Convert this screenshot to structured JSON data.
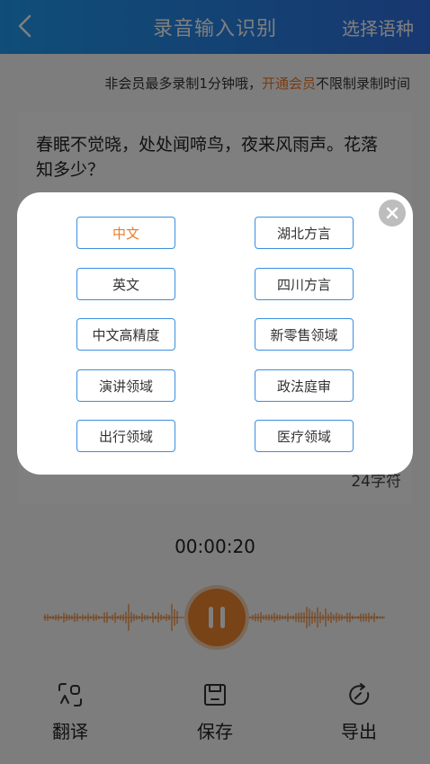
{
  "header": {
    "title": "录音输入识别",
    "lang_button": "选择语种"
  },
  "notice": {
    "prefix": "非会员最多录制1分钟哦，",
    "link": "开通会员",
    "suffix": "不限制录制时间"
  },
  "transcript": {
    "text": "春眠不觉晓，处处闻啼鸟，夜来风雨声。花落知多少？",
    "char_count": "24字符"
  },
  "timer": "00:00:20",
  "toolbar": {
    "translate_label": "翻译",
    "save_label": "保存",
    "export_label": "导出"
  },
  "language_modal": {
    "selected": "中文",
    "options": [
      "中文",
      "湖北方言",
      "英文",
      "四川方言",
      "中文高精度",
      "新零售领域",
      "演讲领域",
      "政法庭审",
      "出行领域",
      "医疗领域"
    ]
  },
  "colors": {
    "header_start": "#1f9cf0",
    "header_end": "#2f6fe0",
    "accent": "#f0862e",
    "link": "#f07a26",
    "option_border": "#3a8fe0"
  }
}
